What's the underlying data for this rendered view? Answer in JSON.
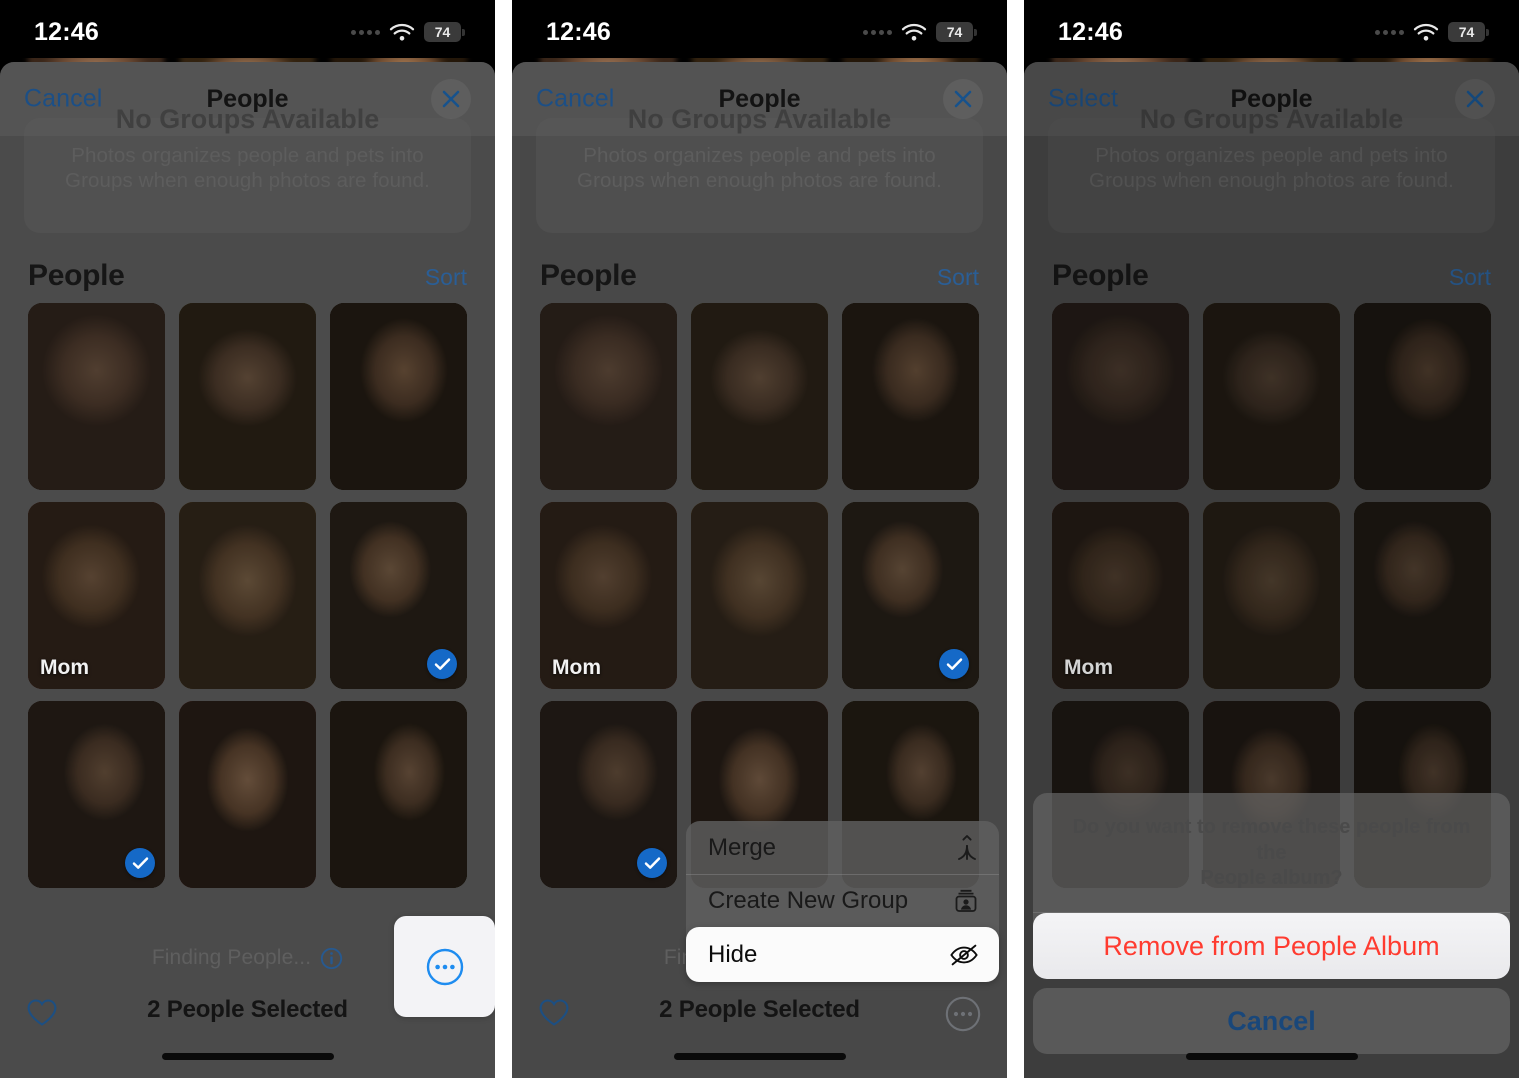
{
  "app": {
    "name": "Photos",
    "platform": "iOS"
  },
  "status_bar": {
    "time": "12:46",
    "battery": "74",
    "wifi_icon": "wifi-icon",
    "signal_icon": "cellular-signal-icon"
  },
  "panels": [
    {
      "id": "panel-1",
      "nav": {
        "left_label": "Cancel",
        "title": "People",
        "close_icon": "close-x-icon"
      },
      "groups_card": {
        "title": "No Groups Available",
        "subtitle_line1": "Photos organizes people and pets into",
        "subtitle_line2": "Groups when enough photos are found."
      },
      "section": {
        "title": "People",
        "sort_label": "Sort"
      },
      "footer": {
        "finding_text": "Finding People...",
        "info_icon": "info-circle-icon"
      },
      "toolbar": {
        "heart_icon": "heart-icon",
        "selection_label": "2 People Selected",
        "more_icon": "more-ellipsis-circle-icon",
        "more_highlighted": true
      },
      "menu": null,
      "action_sheet": null
    },
    {
      "id": "panel-2",
      "nav": {
        "left_label": "Cancel",
        "title": "People",
        "close_icon": "close-x-icon"
      },
      "groups_card": {
        "title": "No Groups Available",
        "subtitle_line1": "Photos organizes people and pets into",
        "subtitle_line2": "Groups when enough photos are found."
      },
      "section": {
        "title": "People",
        "sort_label": "Sort"
      },
      "footer": {
        "finding_text": "Finding People...",
        "info_icon": "info-circle-icon"
      },
      "toolbar": {
        "heart_icon": "heart-icon",
        "selection_label": "2 People Selected",
        "more_icon": "more-ellipsis-circle-icon",
        "more_highlighted": false
      },
      "menu": {
        "items": [
          {
            "label": "Merge",
            "icon": "merge-arrow-icon",
            "highlighted": false
          },
          {
            "label": "Create New Group",
            "icon": "person-in-box-icon",
            "highlighted": false
          },
          {
            "label": "Hide",
            "icon": "eye-slash-icon",
            "highlighted": true
          }
        ]
      },
      "action_sheet": null
    },
    {
      "id": "panel-3",
      "nav": {
        "left_label": "Select",
        "title": "People",
        "close_icon": "close-x-icon"
      },
      "groups_card": {
        "title": "No Groups Available",
        "subtitle_line1": "Photos organizes people and pets into",
        "subtitle_line2": "Groups when enough photos are found."
      },
      "section": {
        "title": "People",
        "sort_label": "Sort"
      },
      "footer": null,
      "toolbar": null,
      "menu": null,
      "action_sheet": {
        "message_line1": "Do you want to remove these people from the",
        "message_line2": "People album?",
        "destructive_label": "Remove from People Album",
        "cancel_label": "Cancel"
      }
    }
  ],
  "people_grid": {
    "rows": 3,
    "columns": 3,
    "cells": [
      {
        "name": "",
        "selected": false
      },
      {
        "name": "",
        "selected": false
      },
      {
        "name": "",
        "selected": false
      },
      {
        "name": "Mom",
        "selected": false
      },
      {
        "name": "",
        "selected": false
      },
      {
        "name": "",
        "selected": true
      },
      {
        "name": "",
        "selected": true
      },
      {
        "name": "",
        "selected": false
      },
      {
        "name": "",
        "selected": false
      }
    ]
  },
  "colors": {
    "ios_blue": "#1569c7",
    "ios_link": "#2a5e96",
    "destructive_red": "#ff3b30",
    "sheet_bg": "#4b4b4b",
    "highlight_white": "#f3f3f6"
  }
}
